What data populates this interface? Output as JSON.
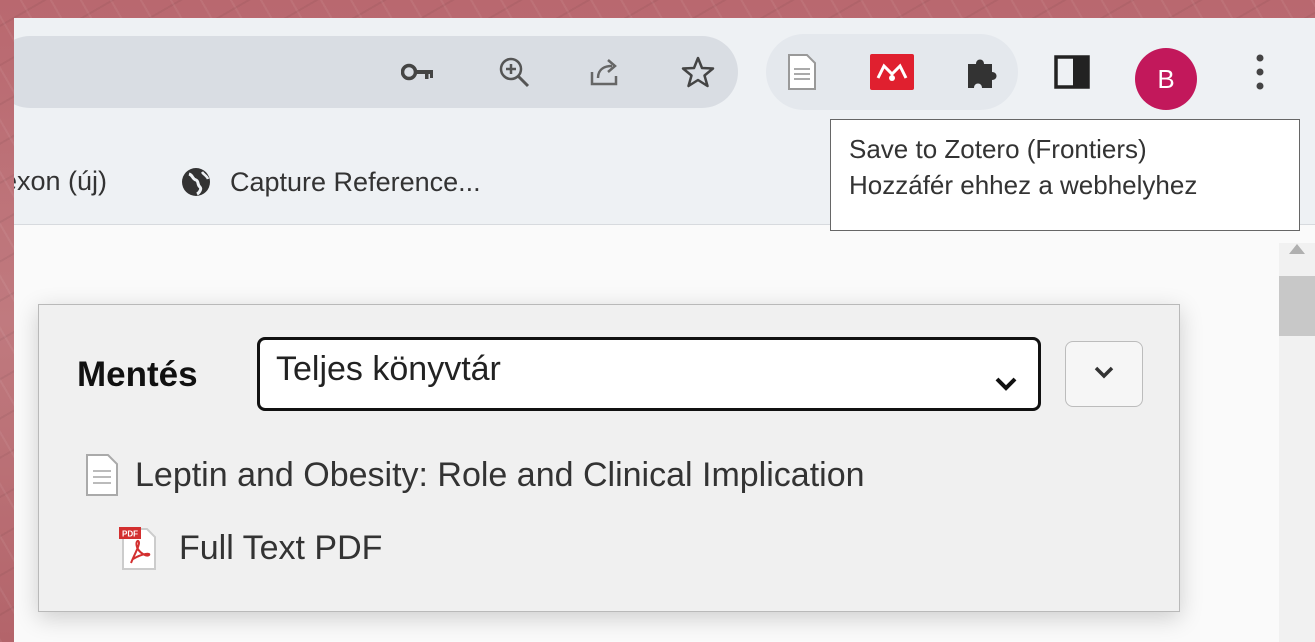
{
  "toolbar": {
    "omnibox_icons": [
      "key-icon",
      "zoom-icon",
      "share-icon",
      "star-icon"
    ],
    "extensions": [
      "document-icon",
      "mendeley-icon",
      "puzzle-icon",
      "side-panel-icon"
    ],
    "avatar_letter": "B",
    "menu_icon": "more-vert-icon",
    "avatar_color": "#c2185b",
    "mendeley_color": "#e0202f"
  },
  "bookmarks": {
    "items": [
      {
        "label": "exon (új)"
      },
      {
        "label": "Capture Reference...",
        "icon": "globe-icon"
      }
    ]
  },
  "tooltip": {
    "line1": "Save to Zotero (Frontiers)",
    "line2": "Hozzáfér ehhez a webhelyhez"
  },
  "zotero_popup": {
    "save_label": "Mentés",
    "selected_library": "Teljes könyvtár",
    "item_title": "Leptin and Obesity: Role and Clinical Implication",
    "attachment_title": "Full Text PDF",
    "pdf_badge": "PDF"
  }
}
